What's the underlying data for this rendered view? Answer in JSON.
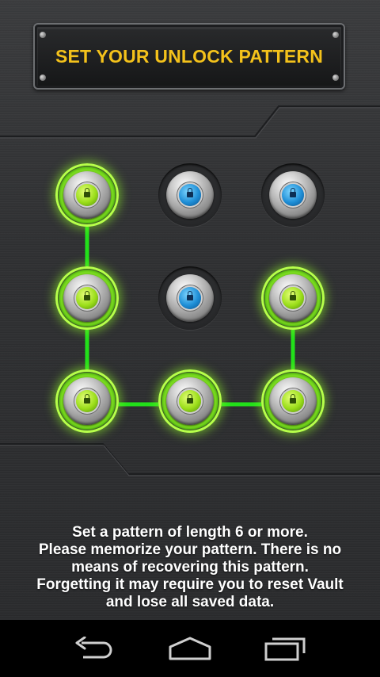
{
  "header": {
    "title": "SET YOUR UNLOCK PATTERN"
  },
  "pattern": {
    "nodes": [
      {
        "id": "top-left",
        "active": true
      },
      {
        "id": "top-center",
        "active": false
      },
      {
        "id": "top-right",
        "active": false
      },
      {
        "id": "middle-left",
        "active": true
      },
      {
        "id": "middle-center",
        "active": false
      },
      {
        "id": "middle-right",
        "active": true
      },
      {
        "id": "bottom-left",
        "active": true
      },
      {
        "id": "bottom-center",
        "active": true
      },
      {
        "id": "bottom-right",
        "active": true
      }
    ],
    "drawn_sequence": [
      1,
      4,
      7,
      8,
      9,
      6
    ],
    "line_color": "#22e01a",
    "active_color": "#8fe82a",
    "inactive_core_color": "#1e8ed6"
  },
  "instructions": {
    "line1": "Set a pattern of length 6 or more.",
    "line2": "Please memorize your pattern. There is no",
    "line3": "means of recovering this pattern.",
    "line4": "Forgetting it may require you to reset Vault",
    "line5": "and lose all saved data."
  },
  "navbar": {
    "back_icon": "back-arrow-icon",
    "home_icon": "home-icon",
    "recents_icon": "recent-apps-icon"
  },
  "colors": {
    "title_text": "#f4c21b",
    "background": "#2f3032"
  }
}
